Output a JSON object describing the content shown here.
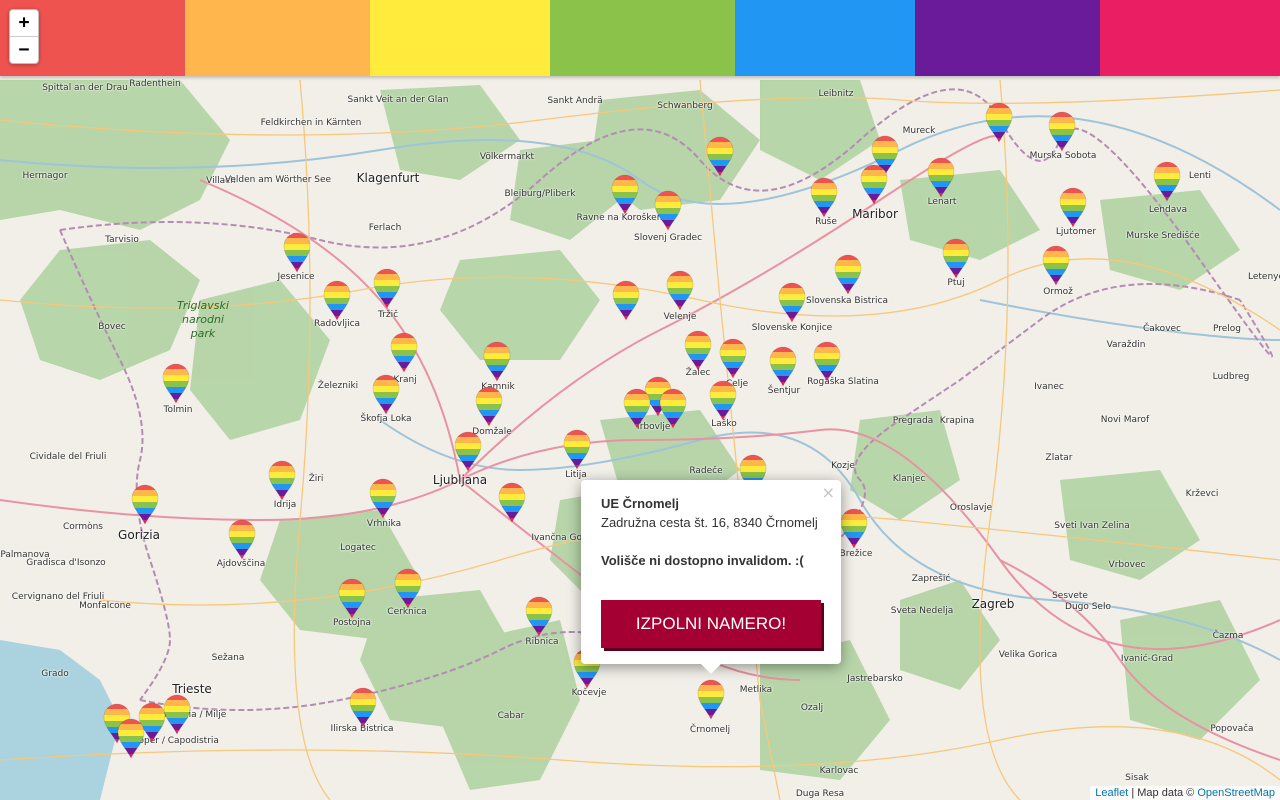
{
  "rainbow_colors": [
    "#ef5350",
    "#ffb74d",
    "#ffeb3b",
    "#8bc34a",
    "#2196f3",
    "#6a1b9a",
    "#e91e63"
  ],
  "zoom": {
    "in_label": "+",
    "out_label": "−"
  },
  "popup": {
    "title": "UE Črnomelj",
    "address": "Zadružna cesta št. 16, 8340 Črnomelj",
    "note": "Volišče ni dostopno invalidom. :(",
    "button_label": "IZPOLNI NAMERO!",
    "close_label": "×"
  },
  "attribution": {
    "leaflet": "Leaflet",
    "separator": " | Map data © ",
    "osm": "OpenStreetMap"
  },
  "map_labels": [
    "Spittal an der Drau",
    "Radenthein",
    "Sankt Veit an der Glan",
    "Sankt Andrä",
    "Schwanberg",
    "Leibnitz",
    "Mureck",
    "Feldkirchen in Kärnten",
    "Völkermarkt",
    "Murska Sobota",
    "Lenti",
    "Hermagor",
    "Villach",
    "Velden am Wörther See",
    "Klagenfurt",
    "Bleiburg/Pliberk",
    "Ravne na Koroškem",
    "Slovenj Gradec",
    "Maribor",
    "Ruše",
    "Lenart",
    "Ljutomer",
    "Lendava",
    "Tarvisio",
    "Ferlach",
    "Jesenice",
    "Murske Središće",
    "Ptuj",
    "Ormož",
    "Letenye",
    "Radovljica",
    "Tržič",
    "Velenje",
    "Slovenska Bistrica",
    "Slovenske Konjice",
    "Čakovec",
    "Bovec",
    "Prelog",
    "Kamnik",
    "Žalec",
    "Šentjur",
    "Rogaška Slatina",
    "Varaždin",
    "Tolmin",
    "Železniki",
    "Kranj",
    "Celje",
    "Ivanec",
    "Ludbreg",
    "Škofja Loka",
    "Domžale",
    "Laško",
    "Pregrada",
    "Krapina",
    "Novi Marof",
    "Cividale del Friuli",
    "Trbovlje",
    "Litija",
    "Radeče",
    "Kozje",
    "Zlatar",
    "Ljubljana",
    "Žiri",
    "Klanjec",
    "Idrija",
    "Krževci",
    "Gorizia",
    "Vrhnika",
    "Oroslavje",
    "Cormòns",
    "Ivančna Gorica",
    "Sveti Ivan Zelina",
    "Palmanova",
    "Logatec",
    "Brežice",
    "Gradisca d'Isonzo",
    "Ajdovščina",
    "Zaprešić",
    "Vrbovec",
    "Cervignano del Friuli",
    "Cerknica",
    "Sesvete",
    "Monfalcone",
    "Postojna",
    "Sveta Nedelja",
    "Zagreb",
    "Dugo Selo",
    "Ribnica",
    "Sežana",
    "Velika Gorica",
    "Čazma",
    "Grado",
    "Kočevje",
    "Jastrebarsko",
    "Ivanić-Grad",
    "Trieste",
    "Metlika",
    "Muggia / Milje",
    "Ilirska Bistrica",
    "Ozalj",
    "Cabar",
    "Popovača",
    "Koper / Capodistria",
    "Črnomelj",
    "Karlovac",
    "Sisak",
    "Duga Resa"
  ],
  "park_label": [
    "Triglavski",
    "narodni",
    "park"
  ],
  "marker_count": 52
}
